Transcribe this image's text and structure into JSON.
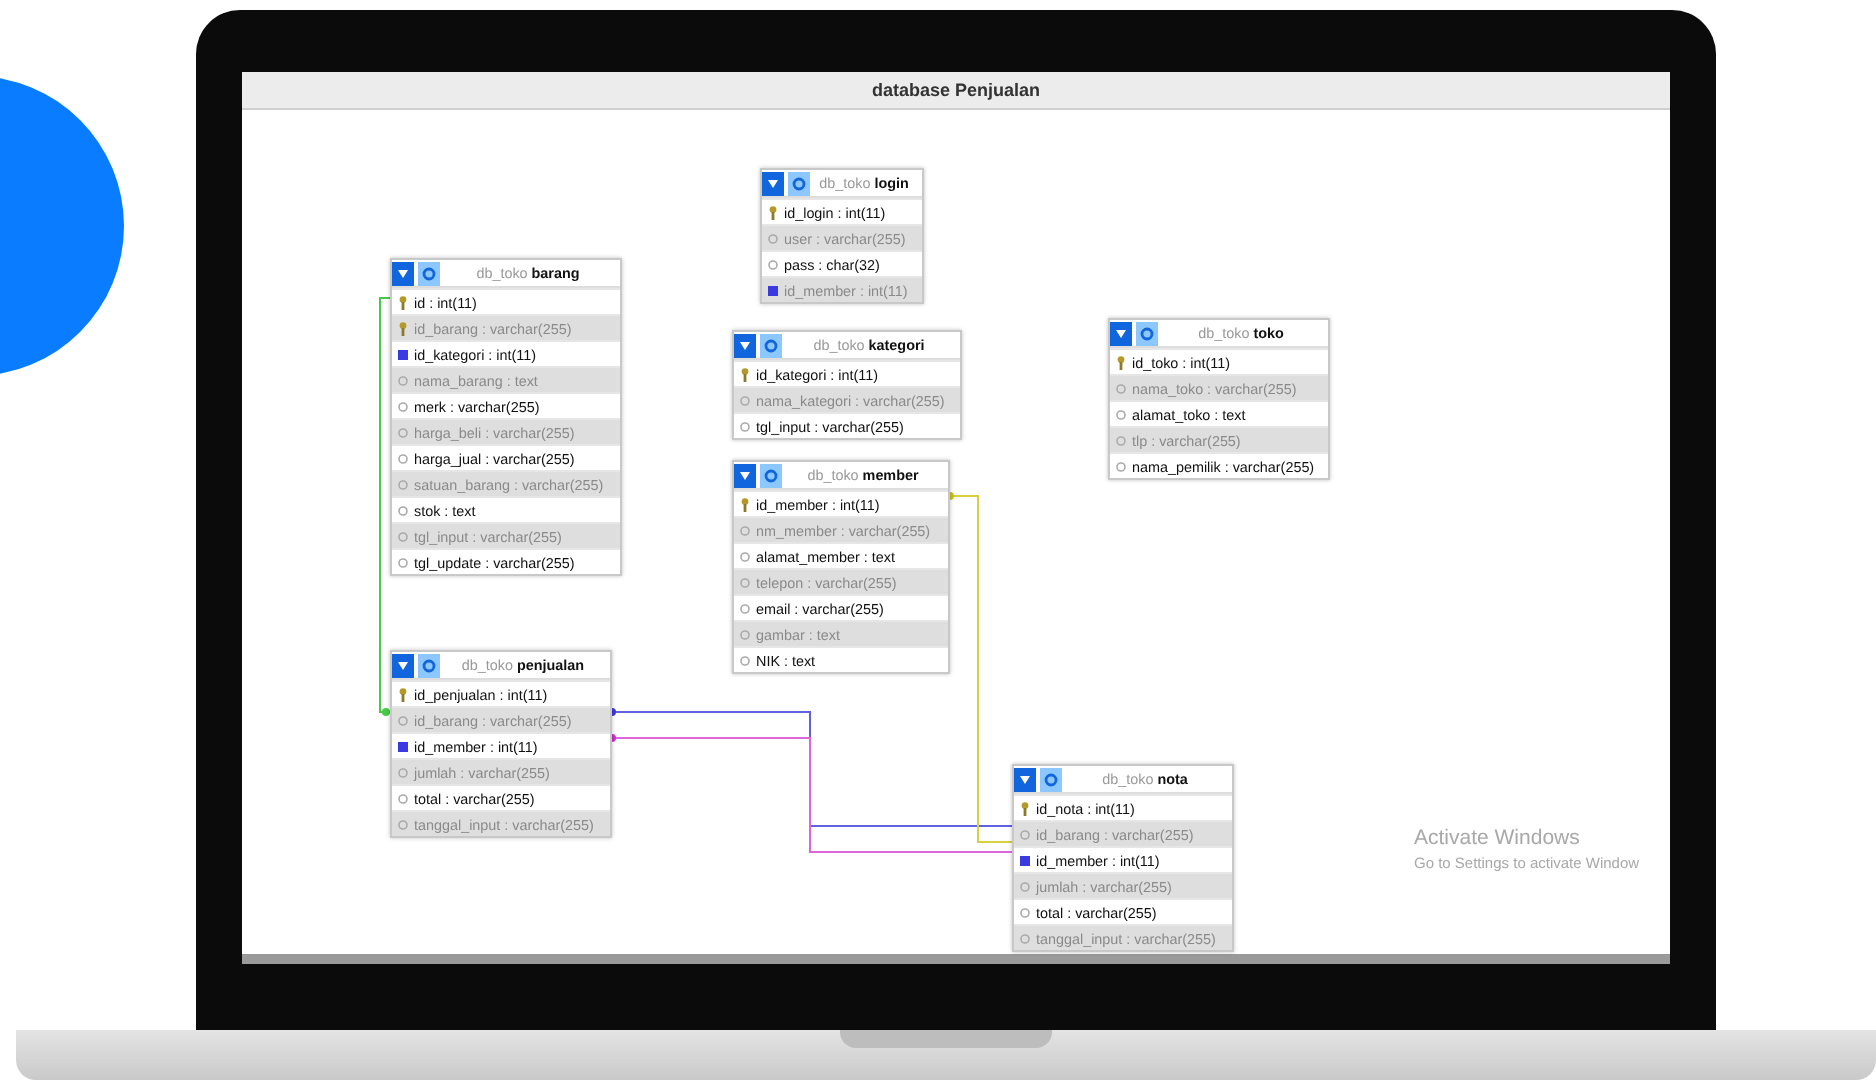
{
  "window": {
    "title": "database Penjualan"
  },
  "tables": [
    {
      "schema": "db_toko",
      "name": "login",
      "fields": [
        {
          "text": "id_login : int(11)",
          "kind": "primary"
        },
        {
          "text": "user : varchar(255)",
          "kind": "normal"
        },
        {
          "text": "pass : char(32)",
          "kind": "normal"
        },
        {
          "text": "id_member : int(11)",
          "kind": "foreign"
        }
      ]
    },
    {
      "schema": "db_toko",
      "name": "barang",
      "fields": [
        {
          "text": "id : int(11)",
          "kind": "primary"
        },
        {
          "text": "id_barang : varchar(255)",
          "kind": "primary"
        },
        {
          "text": "id_kategori : int(11)",
          "kind": "foreign"
        },
        {
          "text": "nama_barang : text",
          "kind": "normal"
        },
        {
          "text": "merk : varchar(255)",
          "kind": "normal"
        },
        {
          "text": "harga_beli : varchar(255)",
          "kind": "normal"
        },
        {
          "text": "harga_jual : varchar(255)",
          "kind": "normal"
        },
        {
          "text": "satuan_barang : varchar(255)",
          "kind": "normal"
        },
        {
          "text": "stok : text",
          "kind": "normal"
        },
        {
          "text": "tgl_input : varchar(255)",
          "kind": "normal"
        },
        {
          "text": "tgl_update : varchar(255)",
          "kind": "normal"
        }
      ]
    },
    {
      "schema": "db_toko",
      "name": "kategori",
      "fields": [
        {
          "text": "id_kategori : int(11)",
          "kind": "primary"
        },
        {
          "text": "nama_kategori : varchar(255)",
          "kind": "normal"
        },
        {
          "text": "tgl_input : varchar(255)",
          "kind": "normal"
        }
      ]
    },
    {
      "schema": "db_toko",
      "name": "member",
      "fields": [
        {
          "text": "id_member : int(11)",
          "kind": "primary"
        },
        {
          "text": "nm_member : varchar(255)",
          "kind": "normal"
        },
        {
          "text": "alamat_member : text",
          "kind": "normal"
        },
        {
          "text": "telepon : varchar(255)",
          "kind": "normal"
        },
        {
          "text": "email : varchar(255)",
          "kind": "normal"
        },
        {
          "text": "gambar : text",
          "kind": "normal"
        },
        {
          "text": "NIK : text",
          "kind": "normal"
        }
      ]
    },
    {
      "schema": "db_toko",
      "name": "toko",
      "fields": [
        {
          "text": "id_toko : int(11)",
          "kind": "primary"
        },
        {
          "text": "nama_toko : varchar(255)",
          "kind": "normal"
        },
        {
          "text": "alamat_toko : text",
          "kind": "normal"
        },
        {
          "text": "tlp : varchar(255)",
          "kind": "normal"
        },
        {
          "text": "nama_pemilik : varchar(255)",
          "kind": "normal"
        }
      ]
    },
    {
      "schema": "db_toko",
      "name": "penjualan",
      "fields": [
        {
          "text": "id_penjualan : int(11)",
          "kind": "primary"
        },
        {
          "text": "id_barang : varchar(255)",
          "kind": "normal"
        },
        {
          "text": "id_member : int(11)",
          "kind": "foreign"
        },
        {
          "text": "jumlah : varchar(255)",
          "kind": "normal"
        },
        {
          "text": "total : varchar(255)",
          "kind": "normal"
        },
        {
          "text": "tanggal_input : varchar(255)",
          "kind": "normal"
        }
      ]
    },
    {
      "schema": "db_toko",
      "name": "nota",
      "fields": [
        {
          "text": "id_nota : int(11)",
          "kind": "primary"
        },
        {
          "text": "id_barang : varchar(255)",
          "kind": "normal"
        },
        {
          "text": "id_member : int(11)",
          "kind": "foreign"
        },
        {
          "text": "jumlah : varchar(255)",
          "kind": "normal"
        },
        {
          "text": "total : varchar(255)",
          "kind": "normal"
        },
        {
          "text": "tanggal_input : varchar(255)",
          "kind": "normal"
        }
      ]
    }
  ],
  "activation_notice": {
    "title": "Activate Windows",
    "subtitle": "Go to Settings to activate Window"
  }
}
